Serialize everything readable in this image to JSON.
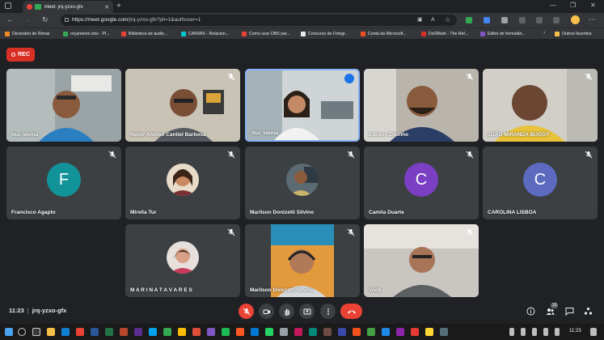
{
  "browser": {
    "tab_title": "Meet: jrq-yzxo-gfx",
    "url_host": "https://meet.google.com",
    "url_path": "/jrq-yzxo-gfx?pli=1&authuser=1"
  },
  "bookmarks": [
    {
      "label": "Dicionário de Rimas",
      "color": "#f28b25"
    },
    {
      "label": "orçamento.xlsx - Pl...",
      "color": "#34a853"
    },
    {
      "label": "Biblioteca de áudio...",
      "color": "#ea4335"
    },
    {
      "label": "CANVAS - Relacion...",
      "color": "#00c4cc"
    },
    {
      "label": "Como usar OBS par...",
      "color": "#ea4335"
    },
    {
      "label": "Concurso de Fotogr...",
      "color": "#e8eaed"
    },
    {
      "label": "Conta da Microsoft...",
      "color": "#f25022"
    },
    {
      "label": "DxOMark - The Ref...",
      "color": "#d93025"
    },
    {
      "label": "Editor de formulári...",
      "color": "#7e57c2"
    }
  ],
  "bookmarks_other": "Outros favoritos",
  "meeting": {
    "rec_label": "REC",
    "time": "11:23",
    "code": "jrq-yzxo-gfx",
    "participant_count": "13"
  },
  "participants": [
    {
      "name": "Nuc Idema",
      "type": "video",
      "muted": false
    },
    {
      "name": "Neilor Afonso Cantiel Barbosa",
      "type": "video",
      "muted": true
    },
    {
      "name": "Nuc Idema",
      "type": "video",
      "speaking": true
    },
    {
      "name": "Edilson Dicinho",
      "type": "video",
      "muted": true
    },
    {
      "name": "JOÃO MIRANDA BUGGY",
      "type": "video",
      "muted": true
    },
    {
      "name": "Francisco Agapto",
      "type": "avatar",
      "initial": "F",
      "color": "#12939a",
      "muted": true
    },
    {
      "name": "Mirella Tur",
      "type": "photo",
      "muted": true
    },
    {
      "name": "Marilson Donizetti Silvino",
      "type": "photo",
      "muted": true
    },
    {
      "name": "Camila Duarte",
      "type": "avatar",
      "initial": "C",
      "color": "#7b3fc4",
      "muted": true
    },
    {
      "name": "CAROLINA LISBOA",
      "type": "avatar",
      "initial": "C",
      "color": "#5c6bc0",
      "muted": true
    },
    {
      "name": "M A R I N A T A V A R E S",
      "type": "photo",
      "muted": true
    },
    {
      "name": "Marilson Donizetti Silvino",
      "type": "video",
      "muted": true
    },
    {
      "name": "Você",
      "type": "video",
      "muted": true
    }
  ],
  "taskbar": {
    "clock": "11:23"
  }
}
